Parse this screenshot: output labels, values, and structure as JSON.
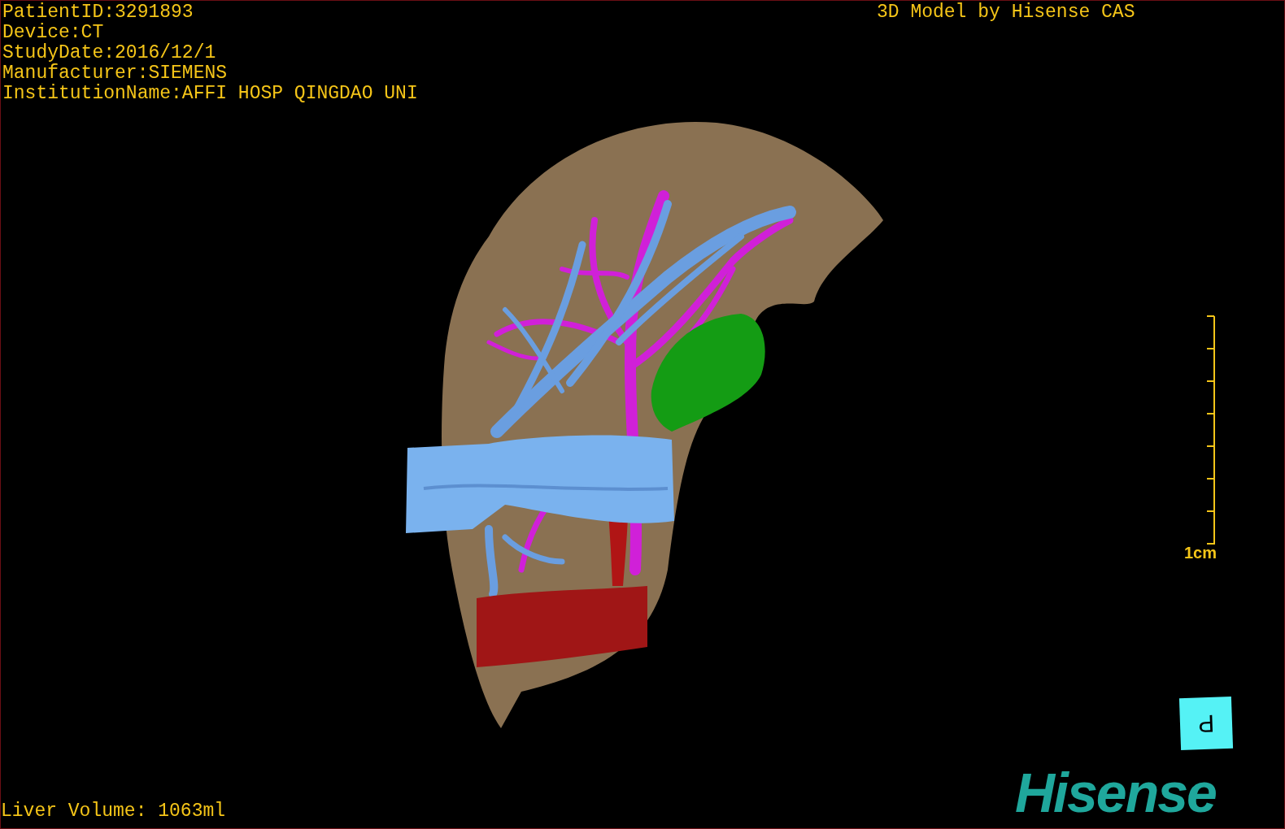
{
  "patient_info": [
    "PatientID:3291893",
    "Device:CT",
    "StudyDate:2016/12/1",
    "Manufacturer:SIEMENS",
    "InstitutionName:AFFI HOSP QINGDAO UNI"
  ],
  "model_credit": "3D Model by Hisense CAS",
  "scale_bar": {
    "label": "1cm"
  },
  "orientation_cube": {
    "label": "P"
  },
  "liver_volume": "Liver Volume: 1063ml",
  "logo": "Hisense"
}
